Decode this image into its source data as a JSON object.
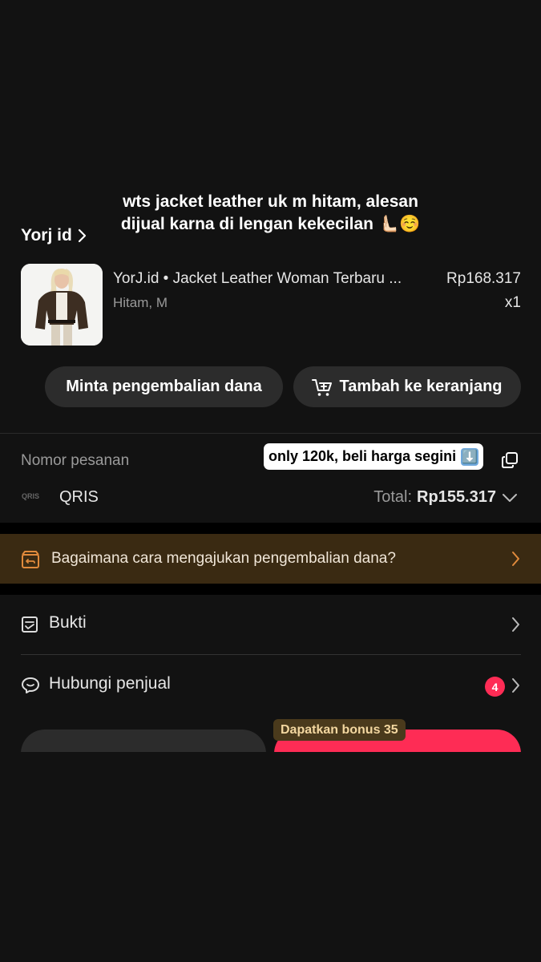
{
  "caption": {
    "line1": "wts jacket leather uk m hitam, alesan",
    "line2": "dijual karna di lengan kekecilan 🫷🏻☺️"
  },
  "store": {
    "name": "Yorj id"
  },
  "product": {
    "title": "YorJ.id • Jacket Leather Woman Terbaru ...",
    "variant": "Hitam, M",
    "price": "Rp168.317",
    "quantity": "x1"
  },
  "actions": {
    "refund_label": "Minta pengembalian dana",
    "cart_label": "Tambah ke keranjang"
  },
  "order": {
    "number_label": "Nomor pesanan",
    "sticker_text": "only 120k, beli harga segini",
    "sticker_emoji": "⬇️",
    "payment_method": "QRIS",
    "payment_logo_text": "QRIS",
    "total_label": "Total:",
    "total_value": "Rp155.317"
  },
  "banner": {
    "text": "Bagaimana cara mengajukan pengembalian dana?"
  },
  "menu": {
    "bukti_label": "Bukti",
    "hubungi_label": "Hubungi penjual",
    "hubungi_badge": "4"
  },
  "bottom": {
    "bonus_label": "Dapatkan bonus 35"
  },
  "colors": {
    "background": "#121212",
    "button_bg": "#2c2c2c",
    "accent_red": "#fe2c55",
    "banner_bg": "#3a2a12",
    "banner_icon": "#e08a3c"
  }
}
